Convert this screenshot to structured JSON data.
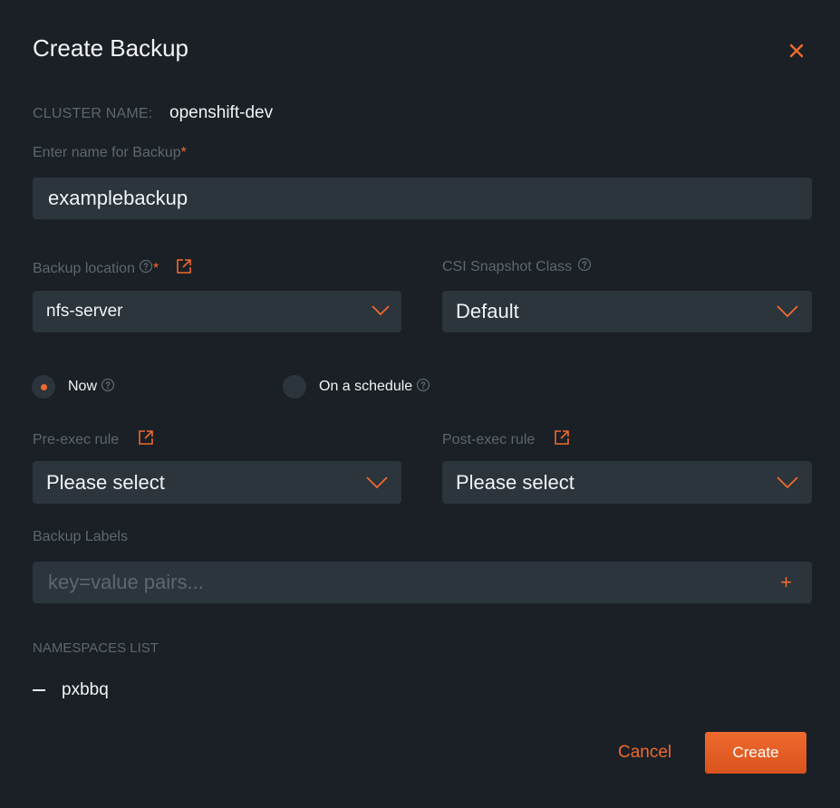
{
  "dialog": {
    "title": "Create Backup"
  },
  "cluster": {
    "label": "CLUSTER NAME:",
    "value": "openshift-dev"
  },
  "backup_name": {
    "label": "Enter name for Backup",
    "required_mark": "*",
    "value": "examplebackup"
  },
  "backup_location": {
    "label": "Backup location",
    "required_mark": "*",
    "selected": "nfs-server"
  },
  "csi_snapshot": {
    "label": "CSI Snapshot Class",
    "selected": "Default"
  },
  "schedule": {
    "options": [
      {
        "label": "Now",
        "selected": true
      },
      {
        "label": "On a schedule",
        "selected": false
      }
    ]
  },
  "pre_exec": {
    "label": "Pre-exec rule",
    "selected": "Please select"
  },
  "post_exec": {
    "label": "Post-exec rule",
    "selected": "Please select"
  },
  "backup_labels": {
    "label": "Backup Labels",
    "placeholder": "key=value pairs...",
    "add_symbol": "+"
  },
  "namespaces": {
    "label": "NAMESPACES LIST",
    "items": [
      "pxbbq"
    ]
  },
  "actions": {
    "cancel_label": "Cancel",
    "create_label": "Create"
  },
  "colors": {
    "background": "#1b2026",
    "field": "#2c343c",
    "accent": "#ef6a2e",
    "muted_text": "#5d6770",
    "text": "#f1f3f5"
  },
  "icons": {
    "close": "close-icon",
    "help": "help-circle-icon",
    "external": "external-link-icon",
    "dropdown": "chevron-down-icon",
    "add": "plus-icon"
  }
}
